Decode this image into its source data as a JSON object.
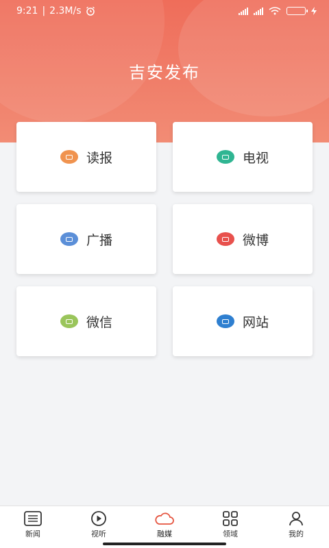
{
  "status_bar": {
    "time": "9:21",
    "speed": "2.3M/s"
  },
  "app_title": "吉安发布",
  "colors": {
    "header_accent": "#ef6d5a",
    "active_tab": "#e5533e"
  },
  "menu": [
    {
      "label": "读报",
      "icon": "newspaper-icon",
      "color": "#f0934f"
    },
    {
      "label": "电视",
      "icon": "tv-icon",
      "color": "#2fb592"
    },
    {
      "label": "广播",
      "icon": "radio-icon",
      "color": "#5b8fd8"
    },
    {
      "label": "微博",
      "icon": "weibo-icon",
      "color": "#e8514d"
    },
    {
      "label": "微信",
      "icon": "wechat-icon",
      "color": "#9ac55b"
    },
    {
      "label": "网站",
      "icon": "globe-icon",
      "color": "#2e7fd0"
    }
  ],
  "tabs": [
    {
      "label": "新闻",
      "icon": "list-icon"
    },
    {
      "label": "视听",
      "icon": "play-icon"
    },
    {
      "label": "融媒",
      "icon": "cloud-icon",
      "active": true
    },
    {
      "label": "领域",
      "icon": "grid-icon"
    },
    {
      "label": "我的",
      "icon": "user-icon"
    }
  ]
}
